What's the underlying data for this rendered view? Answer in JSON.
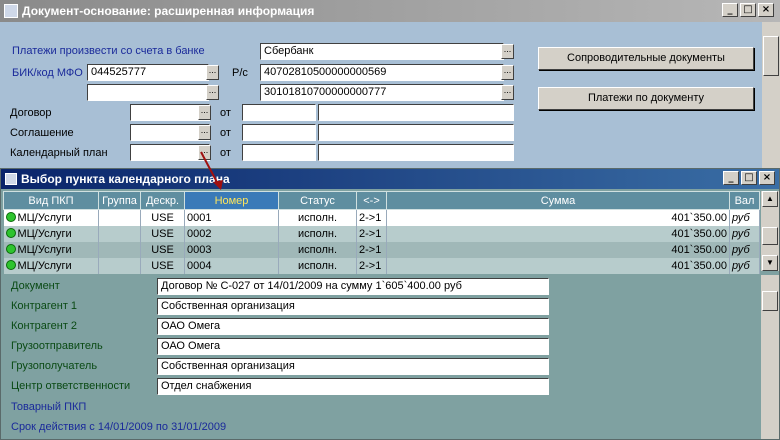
{
  "main_window": {
    "title": "Документ-основание: расширенная информация",
    "controls": {
      "min": "_",
      "max": "□",
      "close": "×"
    },
    "bank_label": "Платежи произвести со счета в банке",
    "bank_value": "Сбербанк",
    "bik_label": "БИК/код МФО",
    "bik_value": "044525777",
    "rs_label": "Р/с",
    "rs_value": "40702810500000000569",
    "ks_value": "30101810700000000777",
    "contract_label": "Договор",
    "agreement_label": "Соглашение",
    "calendar_label": "Календарный план",
    "from_label": "от",
    "ellipsis": "...",
    "btn_accompanying": "Сопроводительные документы",
    "btn_payments": "Платежи по документу"
  },
  "dialog": {
    "title": "Выбор пункта календарного плана",
    "controls": {
      "min": "_",
      "max": "□",
      "close": "×"
    },
    "columns": [
      "Вид ПКП",
      "Группа",
      "Дескр.",
      "Номер",
      "Статус",
      "<->",
      "Сумма",
      "Вал"
    ],
    "rows": [
      {
        "kind": "МЦ/Услуги",
        "group": "",
        "descr": "USE",
        "number": "0001",
        "status": "исполн.",
        "dir": "2->1",
        "sum": "401`350.00",
        "cur": "руб"
      },
      {
        "kind": "МЦ/Услуги",
        "group": "",
        "descr": "USE",
        "number": "0002",
        "status": "исполн.",
        "dir": "2->1",
        "sum": "401`350.00",
        "cur": "руб"
      },
      {
        "kind": "МЦ/Услуги",
        "group": "",
        "descr": "USE",
        "number": "0003",
        "status": "исполн.",
        "dir": "2->1",
        "sum": "401`350.00",
        "cur": "руб"
      },
      {
        "kind": "МЦ/Услуги",
        "group": "",
        "descr": "USE",
        "number": "0004",
        "status": "исполн.",
        "dir": "2->1",
        "sum": "401`350.00",
        "cur": "руб"
      }
    ],
    "details": [
      {
        "label": "Документ",
        "value": "Договор № С-027 от 14/01/2009 на сумму 1`605`400.00 руб"
      },
      {
        "label": "Контрагент 1",
        "value": "Собственная организация"
      },
      {
        "label": "Контрагент 2",
        "value": "ОАО Омега"
      },
      {
        "label": "Грузоотправитель",
        "value": "ОАО Омега"
      },
      {
        "label": "Грузополучатель",
        "value": "Собственная организация"
      },
      {
        "label": "Центр ответственности",
        "value": "Отдел снабжения"
      }
    ],
    "goods_label": "Товарный ПКП",
    "period_label": "Срок действия с 14/01/2009 по 31/01/2009",
    "scroll_up": "▲",
    "scroll_down": "▼"
  },
  "colors": {
    "header": "#5f8ea0",
    "selected_col": "#3a7ab8",
    "status_dot": "#2ec42e"
  }
}
